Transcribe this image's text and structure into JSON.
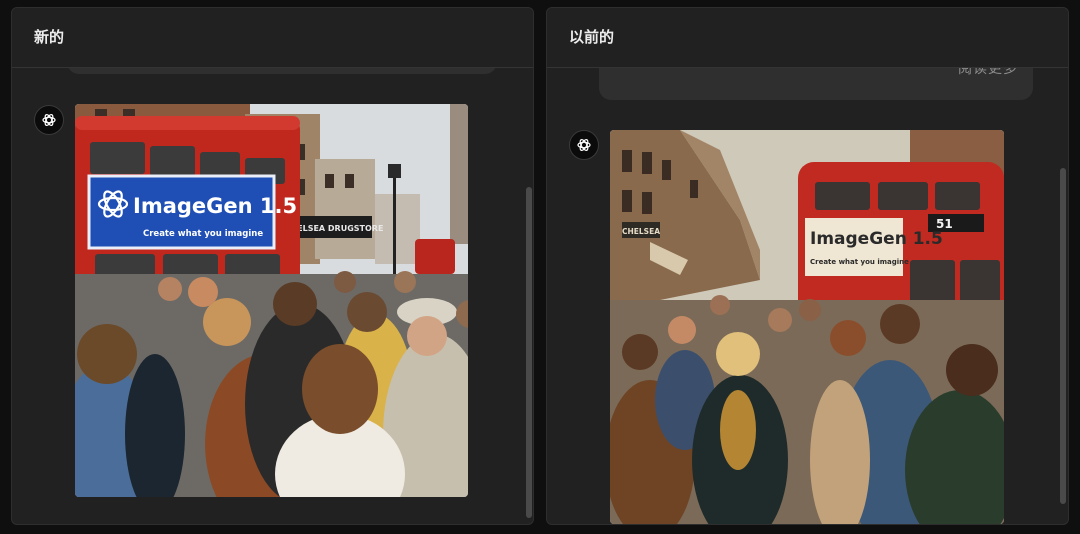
{
  "panels": {
    "new": {
      "title": "新的",
      "image": {
        "bus_ad_brand": "ImageGen 1.5",
        "bus_ad_tagline": "Create what you imagine",
        "storefront_sign": "CHELSEA DRUGSTORE"
      }
    },
    "previous": {
      "title": "以前的",
      "read_more": "阅读更多",
      "image": {
        "bus_ad_brand": "ImageGen 1.5",
        "bus_ad_tagline": "Create what you imagine",
        "bus_route_number": "51",
        "storefront_sign": "CHELSEA"
      }
    }
  },
  "icons": {
    "assistant_avatar": "openai-logo-icon"
  },
  "colors": {
    "page_bg": "#0f0f0f",
    "panel_bg": "#212121",
    "bubble_bg": "#2f2f2f",
    "bus_red": "#c0281e",
    "ad_blue": "#1f4fb5"
  }
}
